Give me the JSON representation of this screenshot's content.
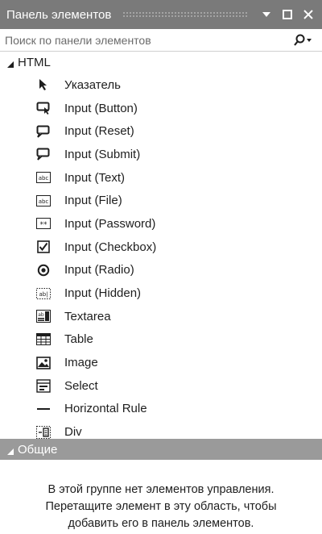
{
  "window": {
    "title": "Панель элементов",
    "buttons": [
      "dropdown-icon",
      "maximize-icon",
      "close-icon"
    ]
  },
  "search": {
    "placeholder": "Поиск по панели элементов",
    "icon": "search-icon"
  },
  "groups": {
    "html": {
      "label": "HTML",
      "expanded": true,
      "items": [
        {
          "label": "Указатель",
          "icon": "pointer-icon"
        },
        {
          "label": "Input (Button)",
          "icon": "input-button-icon"
        },
        {
          "label": "Input (Reset)",
          "icon": "input-reset-icon"
        },
        {
          "label": "Input (Submit)",
          "icon": "input-submit-icon"
        },
        {
          "label": "Input (Text)",
          "icon": "input-text-icon"
        },
        {
          "label": "Input (File)",
          "icon": "input-file-icon"
        },
        {
          "label": "Input (Password)",
          "icon": "input-password-icon"
        },
        {
          "label": "Input (Checkbox)",
          "icon": "checkbox-icon"
        },
        {
          "label": "Input (Radio)",
          "icon": "radio-icon"
        },
        {
          "label": "Input (Hidden)",
          "icon": "input-hidden-icon"
        },
        {
          "label": "Textarea",
          "icon": "textarea-icon"
        },
        {
          "label": "Table",
          "icon": "table-icon"
        },
        {
          "label": "Image",
          "icon": "image-icon"
        },
        {
          "label": "Select",
          "icon": "select-icon"
        },
        {
          "label": "Horizontal Rule",
          "icon": "horizontal-rule-icon"
        },
        {
          "label": "Div",
          "icon": "div-icon"
        }
      ]
    },
    "general": {
      "label": "Общие",
      "expanded": true,
      "empty_message": [
        "В этой группе нет элементов управления.",
        "Перетащите элемент в эту область, чтобы",
        "добавить его в панель элементов."
      ]
    }
  },
  "colors": {
    "title_bar": "#7a7a7a",
    "group_header_selected": "#9a9a9a"
  }
}
